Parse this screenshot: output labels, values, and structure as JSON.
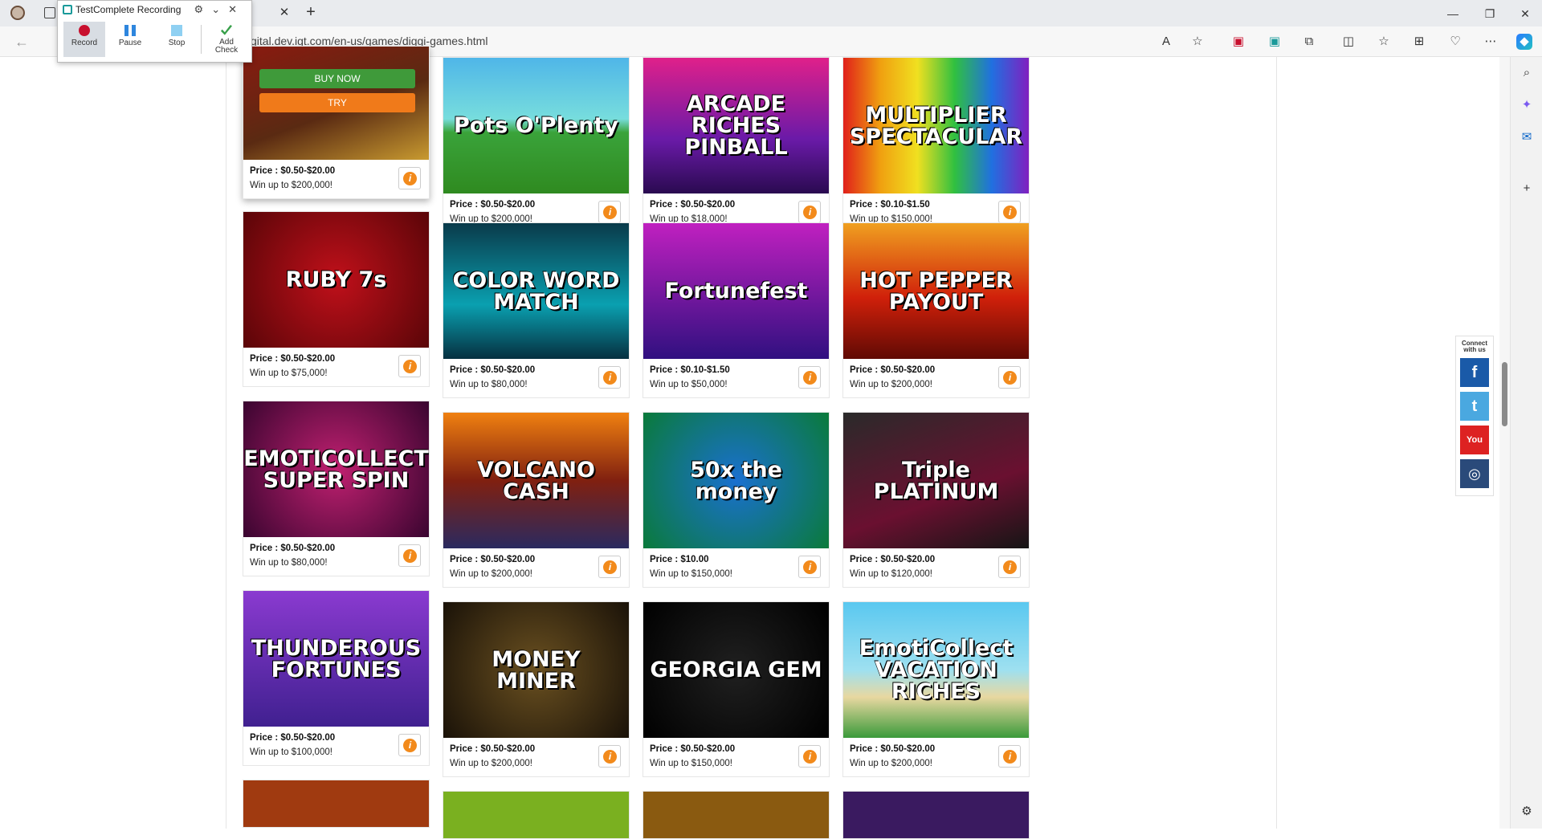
{
  "browser": {
    "url": "gital.dev.igt.com/en-us/games/diggi-games.html"
  },
  "testcomplete": {
    "title": "TestComplete Recording",
    "record": "Record",
    "pause": "Pause",
    "stop": "Stop",
    "add_check": "Add\nCheck"
  },
  "featured": {
    "buy_now": "BUY NOW",
    "try": "TRY"
  },
  "social": {
    "label": "Connect with us"
  },
  "games": [
    {
      "title": "",
      "price": "Price : $0.50-$20.00",
      "win": "Win up to $200,000!",
      "bg": "linear-gradient(160deg,#8a1a10,#5a2a12 55%,#c89a30)"
    },
    {
      "title": "Pots O'Plenty",
      "price": "Price : $0.50-$20.00",
      "win": "Win up to $200,000!",
      "bg": "linear-gradient(180deg,#4fb6e8 0,#7dd 45%,#3aa33a 55%,#2f8a20)"
    },
    {
      "title": "ARCADE RICHES PINBALL",
      "price": "Price : $0.50-$20.00",
      "win": "Win up to $18,000!",
      "bg": "linear-gradient(180deg,#e0208a,#6a1aa8 60%,#2a0a50)"
    },
    {
      "title": "MULTIPLIER SPECTACULAR",
      "price": "Price : $0.10-$1.50",
      "win": "Win up to $150,000!",
      "bg": "linear-gradient(90deg,#e0201a,#f0a010,#f0e020,#30c040,#2070e0,#8020c0)"
    },
    {
      "title": "RUBY 7s",
      "price": "Price : $0.50-$20.00",
      "win": "Win up to $75,000!",
      "bg": "radial-gradient(circle,#c0101a,#5a0508)"
    },
    {
      "title": "COLOR WORD MATCH",
      "price": "Price : $0.50-$20.00",
      "win": "Win up to $80,000!",
      "bg": "linear-gradient(180deg,#0a3a4a,#0aa0b0 60%,#063040)"
    },
    {
      "title": "Fortunefest",
      "price": "Price : $0.10-$1.50",
      "win": "Win up to $50,000!",
      "bg": "linear-gradient(180deg,#c020c0,#301080)"
    },
    {
      "title": "HOT PEPPER PAYOUT",
      "price": "Price : $0.50-$20.00",
      "win": "Win up to $200,000!",
      "bg": "linear-gradient(180deg,#f0a020,#d0200a 55%,#600a04)"
    },
    {
      "title": "EMOTICOLLECT SUPER SPIN",
      "price": "Price : $0.50-$20.00",
      "win": "Win up to $80,000!",
      "bg": "radial-gradient(circle,#c02070,#3a0530)"
    },
    {
      "title": "VOLCANO CASH",
      "price": "Price : $0.50-$20.00",
      "win": "Win up to $200,000!",
      "bg": "linear-gradient(180deg,#f08010,#802010 50%,#2a2a60)"
    },
    {
      "title": "50x the money",
      "price": "Price : $10.00",
      "win": "Win up to $150,000!",
      "bg": "radial-gradient(circle,#1a70d0,#0a7a3a)"
    },
    {
      "title": "Triple PLATINUM",
      "price": "Price : $0.50-$20.00",
      "win": "Win up to $120,000!",
      "bg": "linear-gradient(160deg,#2a2a2a,#6a1030 60%,#151515)"
    },
    {
      "title": "THUNDEROUS FORTUNES",
      "price": "Price : $0.50-$20.00",
      "win": "Win up to $100,000!",
      "bg": "linear-gradient(180deg,#8a3ad0,#402090)"
    },
    {
      "title": "MONEY MINER",
      "price": "Price : $0.50-$20.00",
      "win": "Win up to $200,000!",
      "bg": "radial-gradient(circle,#6a5020,#1a1208)"
    },
    {
      "title": "GEORGIA GEM",
      "price": "Price : $0.50-$20.00",
      "win": "Win up to $150,000!",
      "bg": "radial-gradient(circle,#202020,#000)"
    },
    {
      "title": "EmotiCollect VACATION RICHES",
      "price": "Price : $0.50-$20.00",
      "win": "Win up to $200,000!",
      "bg": "linear-gradient(180deg,#5ac8f0,#9ee0f0 50%,#e8d8a0 70%,#3a9a3a)"
    }
  ]
}
